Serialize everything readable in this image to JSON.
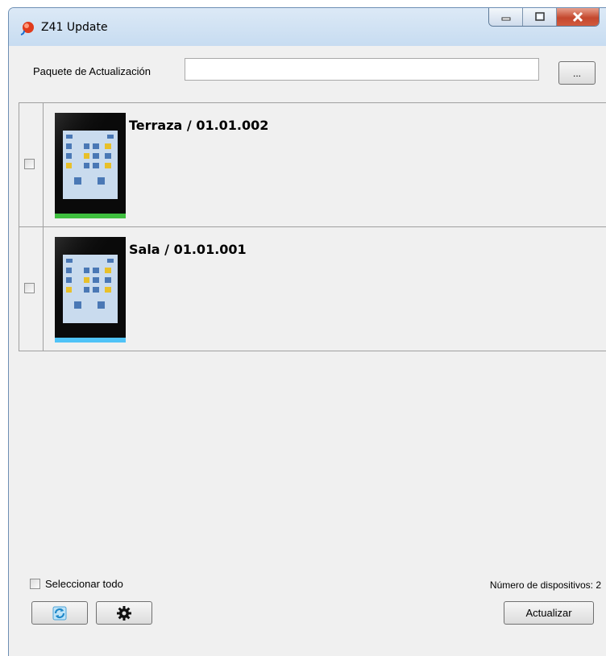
{
  "window": {
    "title": "Z41 Update",
    "accent": "#c4482e"
  },
  "package": {
    "label": "Paquete de Actualización",
    "value": "",
    "browse_label": "..."
  },
  "devices": [
    {
      "name": "Terraza / 01.01.002",
      "checked": false,
      "status_color": "#3fbf3f"
    },
    {
      "name": "Sala / 01.01.001",
      "checked": false,
      "status_color": "#4fc3f7"
    }
  ],
  "footer": {
    "select_all_label": "Seleccionar todo",
    "device_count_label": "Número de dispositivos: 2",
    "update_label": "Actualizar",
    "refresh_icon": "refresh-icon",
    "settings_icon": "gear-icon"
  }
}
